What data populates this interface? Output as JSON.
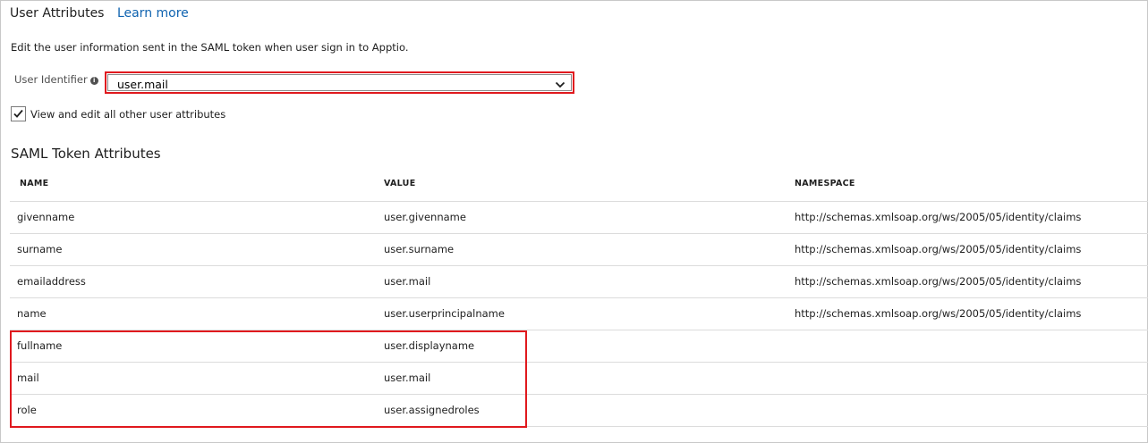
{
  "header": {
    "title": "User Attributes",
    "learn_more": "Learn more"
  },
  "description": "Edit the user information sent in the SAML token when user sign in to Apptio.",
  "user_identifier": {
    "label": "User Identifier",
    "value": "user.mail",
    "info_icon": "info-icon"
  },
  "checkbox": {
    "label": "View and edit all other user attributes",
    "checked": true
  },
  "saml": {
    "title": "SAML Token Attributes",
    "columns": [
      "NAME",
      "VALUE",
      "NAMESPACE"
    ],
    "rows": [
      {
        "name": "givenname",
        "value": "user.givenname",
        "namespace": "http://schemas.xmlsoap.org/ws/2005/05/identity/claims"
      },
      {
        "name": "surname",
        "value": "user.surname",
        "namespace": "http://schemas.xmlsoap.org/ws/2005/05/identity/claims"
      },
      {
        "name": "emailaddress",
        "value": "user.mail",
        "namespace": "http://schemas.xmlsoap.org/ws/2005/05/identity/claims"
      },
      {
        "name": "name",
        "value": "user.userprincipalname",
        "namespace": "http://schemas.xmlsoap.org/ws/2005/05/identity/claims"
      },
      {
        "name": "fullname",
        "value": "user.displayname",
        "namespace": ""
      },
      {
        "name": "mail",
        "value": "user.mail",
        "namespace": ""
      },
      {
        "name": "role",
        "value": "user.assignedroles",
        "namespace": ""
      }
    ]
  },
  "colors": {
    "link": "#0f63b0",
    "highlight": "#e0191e"
  }
}
